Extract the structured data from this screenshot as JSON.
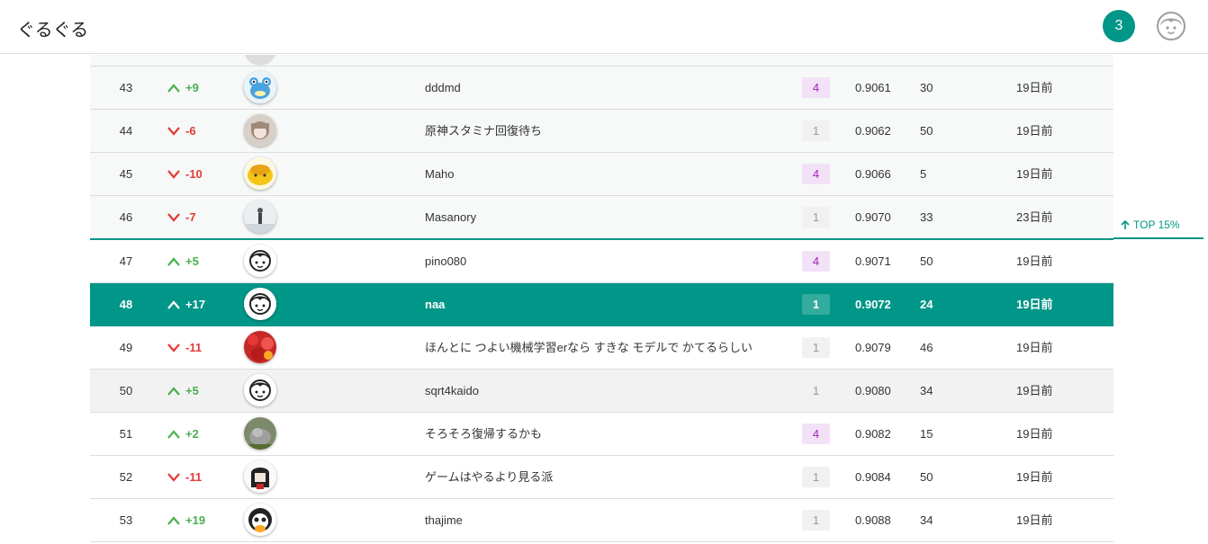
{
  "app": {
    "title": "ぐるぐる",
    "notification_count": "3"
  },
  "leaderboard": {
    "top_marker_label": "TOP 15%",
    "rows": [
      {
        "rank": "43",
        "delta": "+9",
        "dir": "up",
        "avatar": "frog",
        "name": "dddmd",
        "subs": "4",
        "subs_color": "purple",
        "score": "0.9061",
        "entries": "30",
        "last": "19日前"
      },
      {
        "rank": "44",
        "delta": "-6",
        "dir": "down",
        "avatar": "girl",
        "name": "原神スタミナ回復待ち",
        "subs": "1",
        "subs_color": "gray",
        "score": "0.9062",
        "entries": "50",
        "last": "19日前"
      },
      {
        "rank": "45",
        "delta": "-10",
        "dir": "down",
        "avatar": "bun",
        "name": "Maho",
        "subs": "4",
        "subs_color": "purple",
        "score": "0.9066",
        "entries": "5",
        "last": "19日前"
      },
      {
        "rank": "46",
        "delta": "-7",
        "dir": "down",
        "avatar": "person",
        "name": "Masanory",
        "subs": "1",
        "subs_color": "gray",
        "score": "0.9070",
        "entries": "33",
        "last": "23日前"
      },
      {
        "rank": "47",
        "delta": "+5",
        "dir": "up",
        "avatar": "default",
        "name": "pino080",
        "subs": "4",
        "subs_color": "purple",
        "score": "0.9071",
        "entries": "50",
        "last": "19日前"
      },
      {
        "rank": "48",
        "delta": "+17",
        "dir": "up",
        "avatar": "default",
        "name": "naa",
        "subs": "1",
        "subs_color": "gray",
        "score": "0.9072",
        "entries": "24",
        "last": "19日前"
      },
      {
        "rank": "49",
        "delta": "-11",
        "dir": "down",
        "avatar": "flower",
        "name": "ほんとに つよい機械学習erなら すきな モデルで かてるらしい",
        "subs": "1",
        "subs_color": "gray",
        "score": "0.9079",
        "entries": "46",
        "last": "19日前"
      },
      {
        "rank": "50",
        "delta": "+5",
        "dir": "up",
        "avatar": "default",
        "name": "sqrt4kaido",
        "subs": "1",
        "subs_color": "gray",
        "score": "0.9080",
        "entries": "34",
        "last": "19日前"
      },
      {
        "rank": "51",
        "delta": "+2",
        "dir": "up",
        "avatar": "rock",
        "name": "そろそろ復帰するかも",
        "subs": "4",
        "subs_color": "purple",
        "score": "0.9082",
        "entries": "15",
        "last": "19日前"
      },
      {
        "rank": "52",
        "delta": "-11",
        "dir": "down",
        "avatar": "anime",
        "name": "ゲームはやるより見る派",
        "subs": "1",
        "subs_color": "gray",
        "score": "0.9084",
        "entries": "50",
        "last": "19日前"
      },
      {
        "rank": "53",
        "delta": "+19",
        "dir": "up",
        "avatar": "panda",
        "name": "thajime",
        "subs": "1",
        "subs_color": "gray",
        "score": "0.9088",
        "entries": "34",
        "last": "19日前"
      }
    ]
  }
}
